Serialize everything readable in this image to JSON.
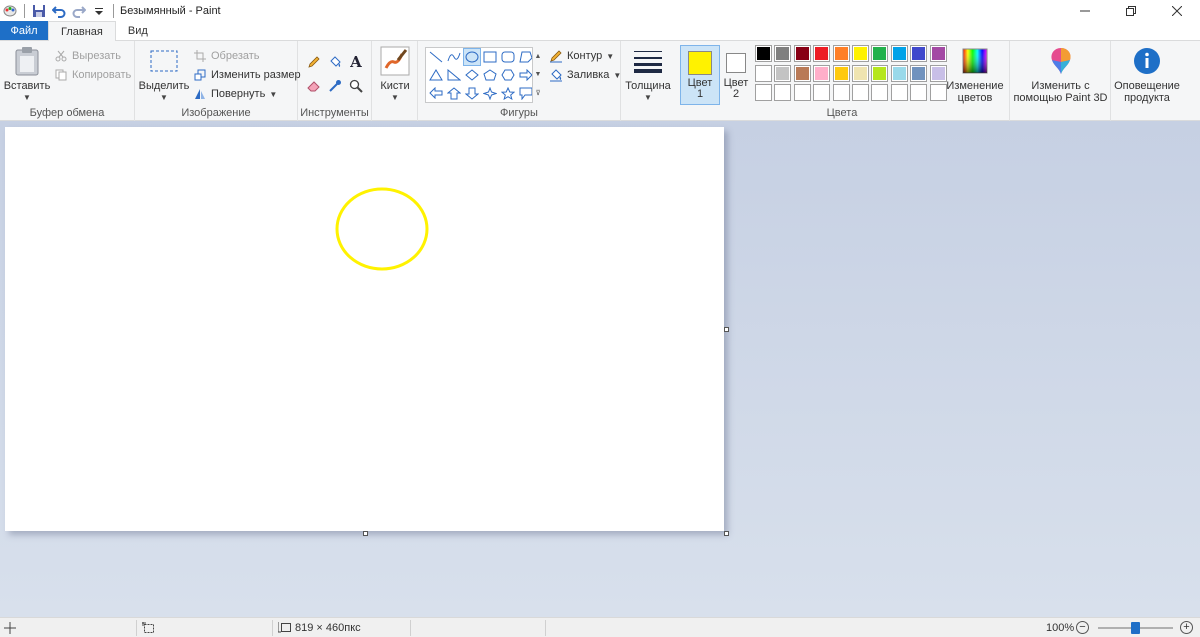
{
  "window": {
    "title": "Безымянный - Paint"
  },
  "tabs": [
    {
      "label": "Файл"
    },
    {
      "label": "Главная"
    },
    {
      "label": "Вид"
    }
  ],
  "ribbon": {
    "clipboard": {
      "group_label": "Буфер обмена",
      "paste": "Вставить",
      "cut": "Вырезать",
      "copy": "Копировать"
    },
    "image": {
      "group_label": "Изображение",
      "select": "Выделить",
      "crop": "Обрезать",
      "resize": "Изменить размер",
      "rotate": "Повернуть"
    },
    "tools": {
      "group_label": "Инструменты"
    },
    "brushes": {
      "label": "Кисти"
    },
    "shapes": {
      "group_label": "Фигуры",
      "outline": "Контур",
      "fill": "Заливка"
    },
    "thickness": {
      "label": "Толщина"
    },
    "colors": {
      "group_label": "Цвета",
      "color1": "Цвет 1",
      "color2": "Цвет 2",
      "color1_value": "#fff200",
      "color2_value": "#ffffff",
      "edit_colors": "Изменение цветов",
      "palette_row1": [
        "#000000",
        "#7f7f7f",
        "#880015",
        "#ed1c24",
        "#ff7f27",
        "#fff200",
        "#22b14c",
        "#00a2e8",
        "#3f48cc",
        "#a349a4"
      ],
      "palette_row2": [
        "#ffffff",
        "#c3c3c3",
        "#b97a57",
        "#ffaec9",
        "#ffc90e",
        "#efe4b0",
        "#b5e61d",
        "#99d9ea",
        "#7092be",
        "#c8bfe7"
      ],
      "palette_row3": [
        "#ffffff",
        "#ffffff",
        "#ffffff",
        "#ffffff",
        "#ffffff",
        "#ffffff",
        "#ffffff",
        "#ffffff",
        "#ffffff",
        "#ffffff"
      ]
    },
    "paint3d": "Изменить с помощью Paint 3D",
    "notifications": "Оповещение продукта"
  },
  "canvas": {
    "ellipse_color": "#fff200"
  },
  "status": {
    "dimensions": "819 × 460пкс",
    "zoom": "100%"
  }
}
